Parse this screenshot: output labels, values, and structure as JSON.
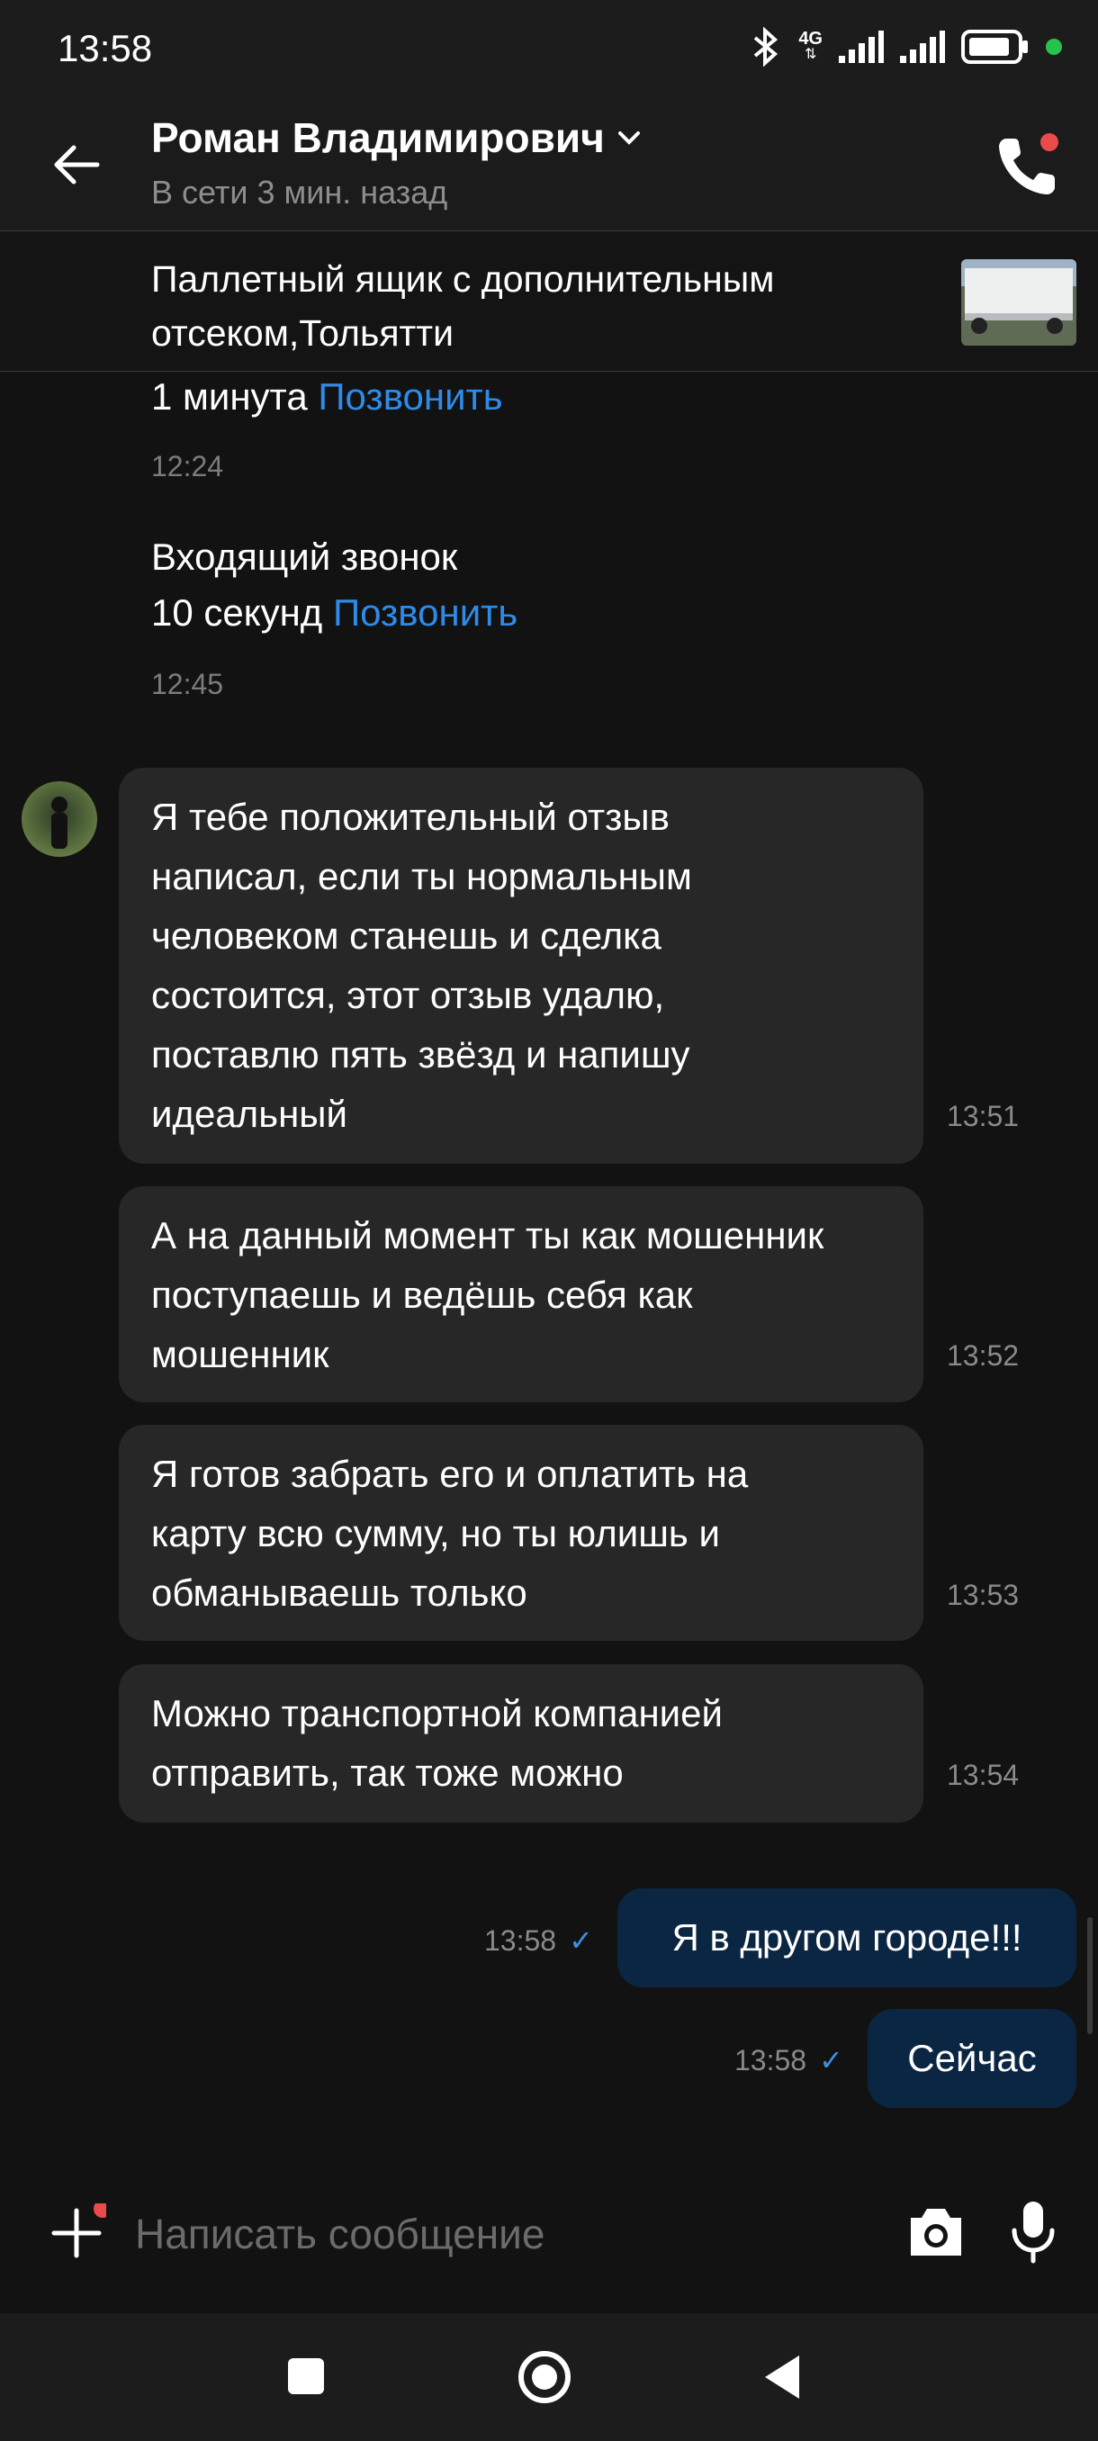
{
  "status_bar": {
    "time": "13:58",
    "network": "4G"
  },
  "header": {
    "contact_name": "Роман Владимирович",
    "contact_status": "В сети 3 мин. назад"
  },
  "item": {
    "title": "Паллетный ящик с дополнительным отсеком,Тольятти"
  },
  "calls": [
    {
      "type": "",
      "duration": "1 минута",
      "action": "Позвонить",
      "time": "12:24"
    },
    {
      "type": "Входящий звонок",
      "duration": "10 секунд",
      "action": "Позвонить",
      "time": "12:45"
    }
  ],
  "incoming": [
    {
      "lines": [
        "Я тебе положительный отзыв",
        "написал, если ты нормальным",
        "человеком станешь и сделка",
        "состоится, этот отзыв удалю,",
        "поставлю пять звёзд и напишу",
        "идеальный"
      ],
      "time": "13:51"
    },
    {
      "lines": [
        "А на данный момент ты как мошенник",
        "поступаешь и ведёшь себя как",
        "мошенник"
      ],
      "time": "13:52"
    },
    {
      "lines": [
        "Я готов забрать его и оплатить на",
        "карту всю сумму, но ты юлишь и",
        "обманываешь только"
      ],
      "time": "13:53"
    },
    {
      "lines": [
        "Можно транспортной компанией",
        "отправить, так тоже можно"
      ],
      "time": "13:54"
    }
  ],
  "outgoing": [
    {
      "text": "Я в другом городе!!!",
      "time": "13:58",
      "status": "✓"
    },
    {
      "text": "Сейчас",
      "time": "13:58",
      "status": "✓"
    }
  ],
  "composer": {
    "placeholder": "Написать сообщение"
  },
  "colors": {
    "accent_link": "#2f8be8",
    "outgoing_bubble": "#0b2643",
    "incoming_bubble": "#272727",
    "badge_red": "#e94b4b",
    "online_green": "#27c24c"
  },
  "icons": [
    "bluetooth-icon",
    "signal-icon",
    "battery-icon",
    "back-arrow-icon",
    "chevron-down-icon",
    "phone-icon",
    "plus-icon",
    "camera-icon",
    "microphone-icon",
    "nav-square-icon",
    "nav-home-icon",
    "nav-back-icon"
  ]
}
